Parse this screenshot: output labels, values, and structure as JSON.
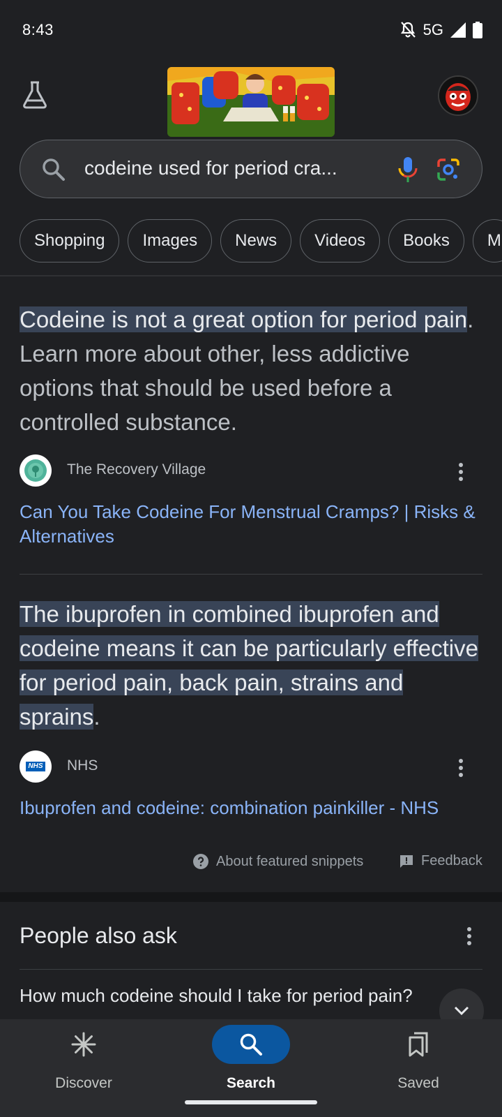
{
  "status_bar": {
    "time": "8:43",
    "network": "5G",
    "icons": [
      "notifications-off-icon",
      "signal-icon",
      "battery-icon"
    ]
  },
  "header": {
    "labs_icon": "flask-icon",
    "doodle_icon": "google-doodle",
    "avatar_icon": "profile-avatar"
  },
  "search": {
    "query": "codeine used for period cra...",
    "icons": [
      "search-icon",
      "mic-icon",
      "lens-icon"
    ]
  },
  "chips": [
    "Shopping",
    "Images",
    "News",
    "Videos",
    "Books",
    "M"
  ],
  "snippets": [
    {
      "highlight": "Codeine is not a great option for period pain",
      "rest": ". Learn more about other, less addictive options that should be used before a controlled substance.",
      "source_name": "The Recovery Village",
      "link": "Can You Take Codeine For Menstrual Cramps? | Risks & Alternatives"
    },
    {
      "highlight": "The ibuprofen in combined ibuprofen and codeine means it can be particularly effective for period pain, back pain, strains and sprains",
      "rest": ".",
      "source_name": "NHS",
      "favicon_text": "NHS",
      "link": "Ibuprofen and codeine: combination painkiller - NHS"
    }
  ],
  "snippet_footer": {
    "about": "About featured snippets",
    "feedback": "Feedback"
  },
  "people_also_ask": {
    "title": "People also ask",
    "question": "How much codeine should I take for period pain?"
  },
  "bottom_nav": {
    "discover": "Discover",
    "search": "Search",
    "saved": "Saved"
  },
  "colors": {
    "background": "#1f2023",
    "link": "#8ab4f8",
    "highlight": "#394457",
    "active_nav": "#0b57a0"
  }
}
